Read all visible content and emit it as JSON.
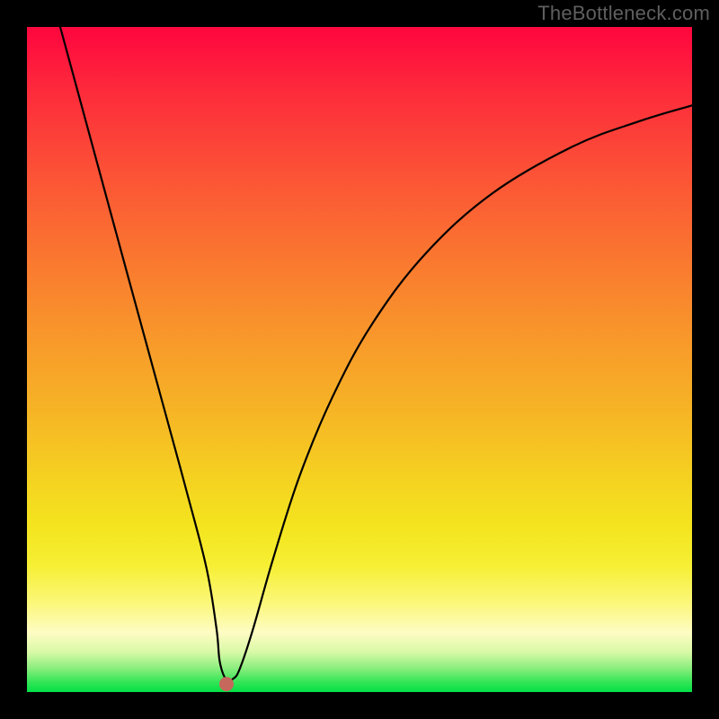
{
  "watermark": "TheBottleneck.com",
  "chart_data": {
    "type": "line",
    "title": "",
    "xlabel": "",
    "ylabel": "",
    "xlim": [
      0,
      1
    ],
    "ylim": [
      0,
      1
    ],
    "grid": false,
    "legend": false,
    "background_gradient": {
      "direction": "vertical",
      "stops": [
        {
          "pos": 0.0,
          "color": "#fe093e"
        },
        {
          "pos": 0.22,
          "color": "#fc5236"
        },
        {
          "pos": 0.46,
          "color": "#f8962b"
        },
        {
          "pos": 0.68,
          "color": "#f5d221"
        },
        {
          "pos": 0.81,
          "color": "#f6ef34"
        },
        {
          "pos": 0.91,
          "color": "#fefcc3"
        },
        {
          "pos": 0.965,
          "color": "#88ee7c"
        },
        {
          "pos": 1.0,
          "color": "#04e046"
        }
      ]
    },
    "series": [
      {
        "name": "bottleneck-curve",
        "x": [
          0.05,
          0.1,
          0.15,
          0.2,
          0.24,
          0.27,
          0.285,
          0.29,
          0.3,
          0.31,
          0.32,
          0.34,
          0.37,
          0.41,
          0.46,
          0.52,
          0.6,
          0.7,
          0.82,
          0.92,
          1.0
        ],
        "y": [
          1.0,
          0.816,
          0.632,
          0.449,
          0.302,
          0.186,
          0.095,
          0.045,
          0.018,
          0.02,
          0.035,
          0.095,
          0.2,
          0.325,
          0.445,
          0.555,
          0.66,
          0.75,
          0.82,
          0.858,
          0.882
        ]
      }
    ],
    "marker": {
      "x": 0.3,
      "y": 0.012,
      "color": "#c6685b",
      "radius_px": 8
    }
  }
}
